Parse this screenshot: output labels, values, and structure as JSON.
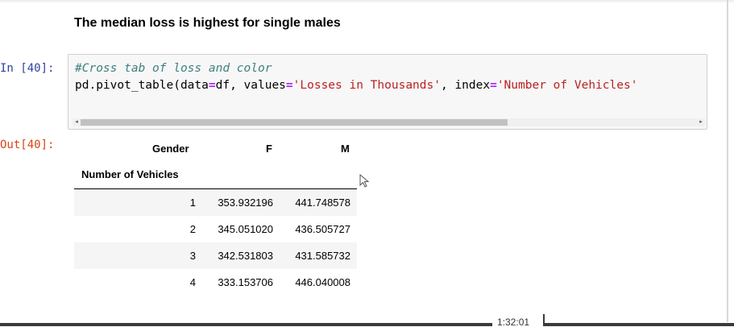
{
  "markdown": {
    "heading": "The median loss is highest for single males"
  },
  "input_cell": {
    "prompt": "In [40]:",
    "code_comment": "#Cross tab of loss and color",
    "code_parts": {
      "func": "pd.pivot_table(data",
      "eq1": "=",
      "arg1": "df, values",
      "eq2": "=",
      "str1": "'Losses in Thousands'",
      "sep": ", index",
      "eq3": "=",
      "str2": "'Number of Vehicles'"
    }
  },
  "output_cell": {
    "prompt": "Out[40]:",
    "columns_name": "Gender",
    "columns": [
      "F",
      "M"
    ],
    "index_name": "Number of Vehicles",
    "rows": [
      {
        "index": "1",
        "F": "353.932196",
        "M": "441.748578"
      },
      {
        "index": "2",
        "F": "345.051020",
        "M": "436.505727"
      },
      {
        "index": "3",
        "F": "342.531803",
        "M": "431.585732"
      },
      {
        "index": "4",
        "F": "333.153706",
        "M": "446.040008"
      }
    ]
  },
  "video": {
    "timestamp": "1:32:01"
  }
}
